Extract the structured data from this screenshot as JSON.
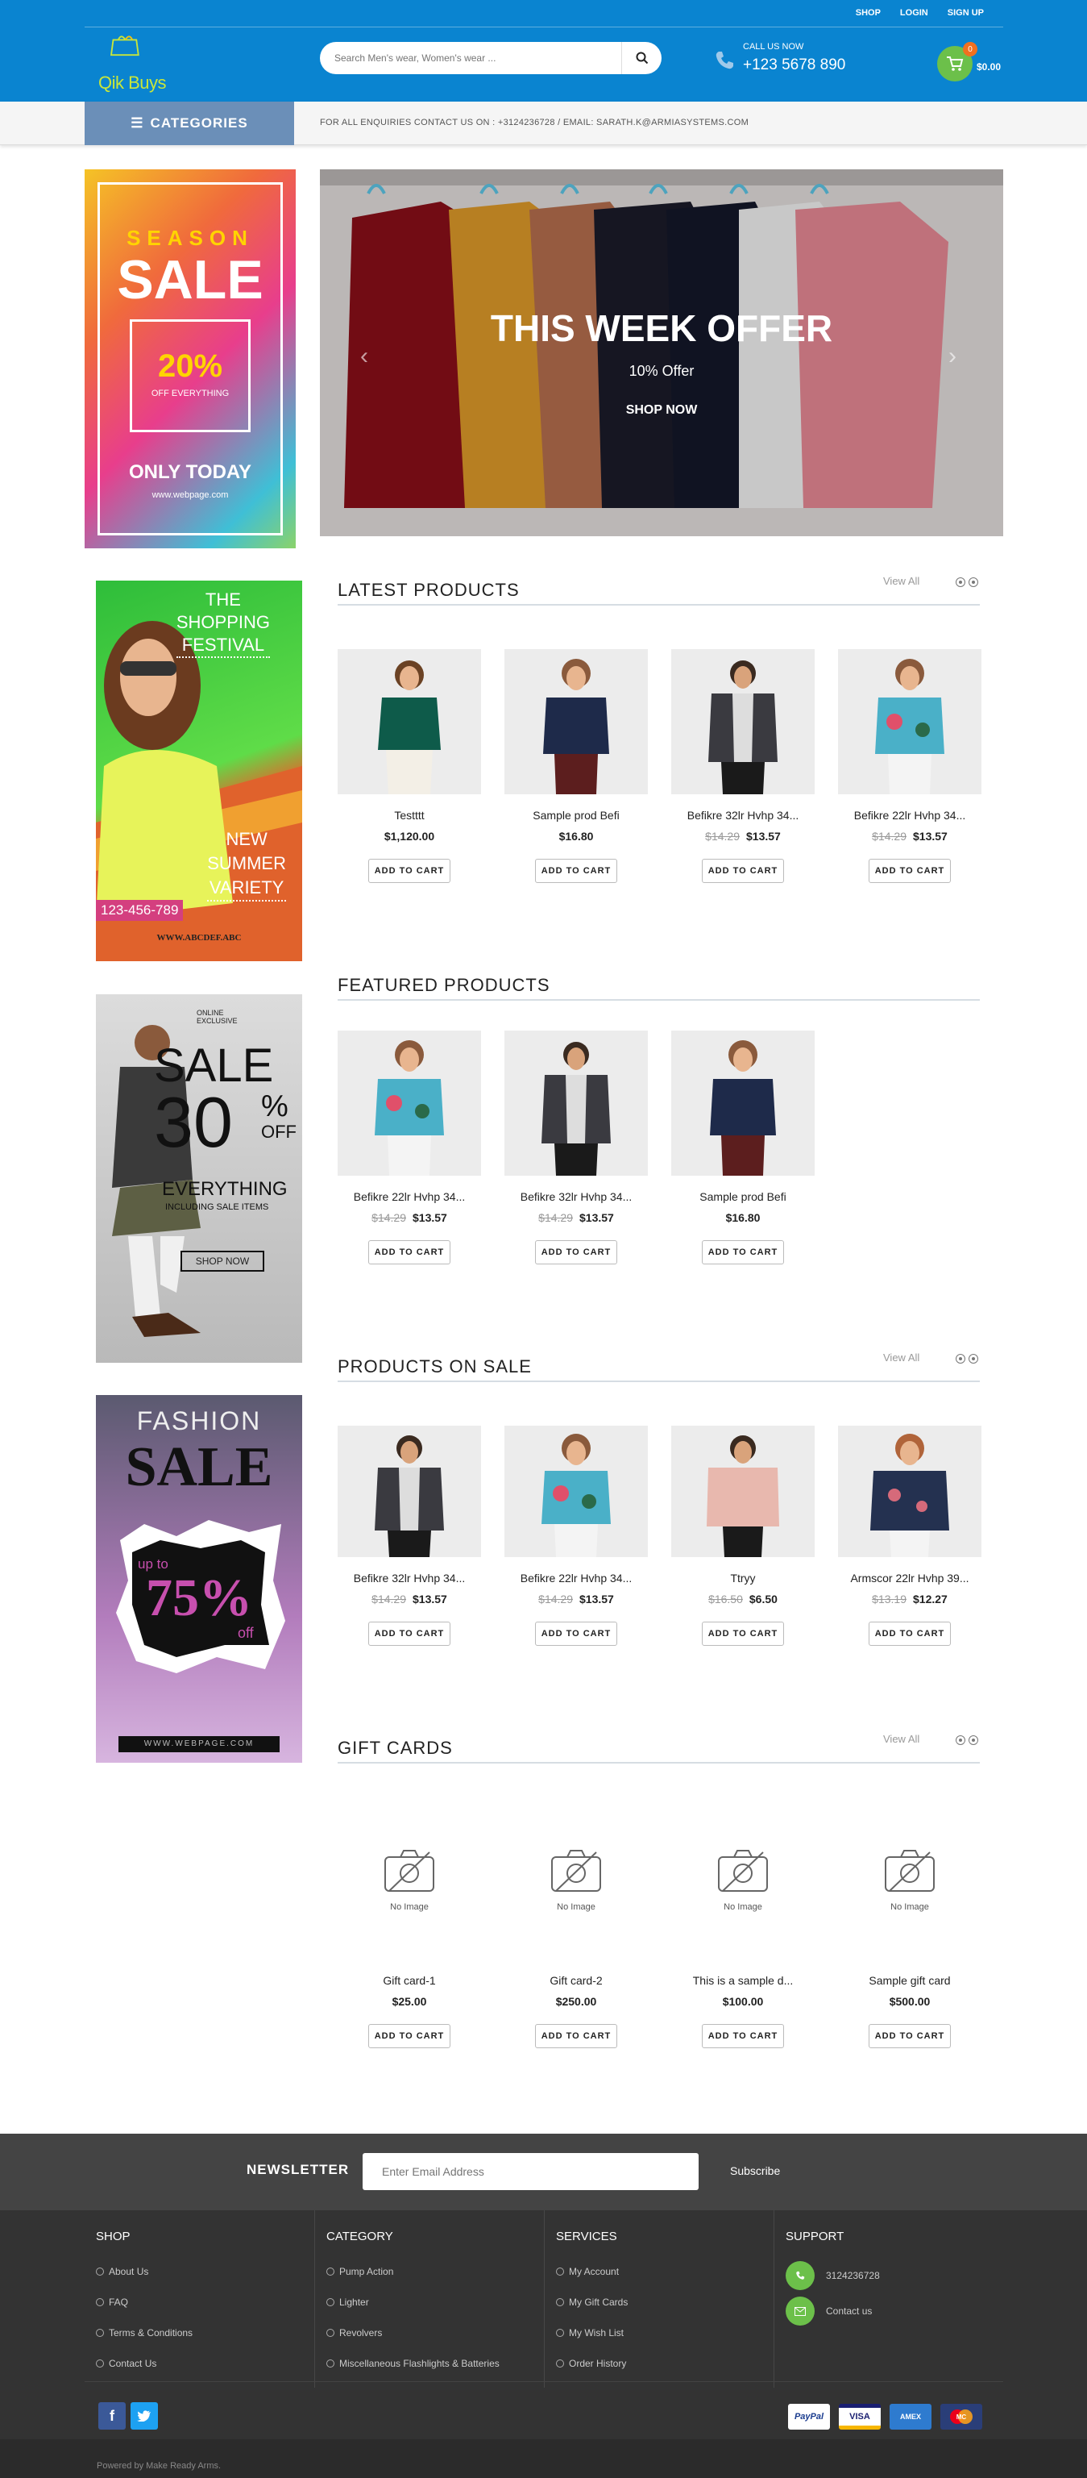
{
  "header": {
    "top_nav": [
      "SHOP",
      "LOGIN",
      "SIGN UP"
    ],
    "logo_text": "Qik Buys",
    "search_placeholder": "Search Men's wear, Women's wear ...",
    "call_label": "CALL US NOW",
    "phone": "+123 5678 890",
    "cart_count": "0",
    "cart_total": "$0.00"
  },
  "catbar": {
    "label": "CATEGORIES",
    "enquiry": "FOR ALL ENQUIRIES CONTACT US ON : +3124236728 / EMAIL: SARATH.K@ARMIASYSTEMS.COM"
  },
  "hero": {
    "title": "THIS WEEK OFFER",
    "subtitle": "10% Offer",
    "cta": "SHOP NOW"
  },
  "banners": {
    "season": {
      "line1": "SEASON",
      "line2": "SALE",
      "pct": "20%",
      "pct_sub": "OFF EVERYTHING",
      "only": "ONLY TODAY",
      "site": "www.webpage.com"
    },
    "festival": {
      "line1": "THE",
      "line2": "SHOPPING",
      "line3": "FESTIVAL",
      "new1": "NEW",
      "new2": "SUMMER",
      "new3": "VARIETY",
      "phone": "123-456-789",
      "site": "WWW.ABCDEF.ABC"
    },
    "sale30": {
      "top": "ONLINE EXCLUSIVE",
      "sale": "SALE",
      "num": "30",
      "pct": "%",
      "off": "OFF",
      "every": "EVERYTHING",
      "incl": "INCLUDING SALE ITEMS",
      "btn": "SHOP NOW"
    },
    "fashion": {
      "line1": "FASHION",
      "line2": "SALE",
      "upto": "up to",
      "pct": "75%",
      "off": "off",
      "site": "WWW.WEBPAGE.COM"
    }
  },
  "sections": {
    "latest": {
      "title": "LATEST PRODUCTS",
      "view_all": "View All",
      "items": [
        {
          "name": "Testttt",
          "old": "",
          "price": "$1,120.00"
        },
        {
          "name": "Sample prod Befi",
          "old": "",
          "price": "$16.80"
        },
        {
          "name": "Befikre 32lr Hvhp 34...",
          "old": "$14.29",
          "price": "$13.57"
        },
        {
          "name": "Befikre 22lr Hvhp 34...",
          "old": "$14.29",
          "price": "$13.57"
        }
      ]
    },
    "featured": {
      "title": "FEATURED PRODUCTS",
      "items": [
        {
          "name": "Befikre 22lr Hvhp 34...",
          "old": "$14.29",
          "price": "$13.57"
        },
        {
          "name": "Befikre 32lr Hvhp 34...",
          "old": "$14.29",
          "price": "$13.57"
        },
        {
          "name": "Sample prod Befi",
          "old": "",
          "price": "$16.80"
        }
      ]
    },
    "sale": {
      "title": "PRODUCTS ON SALE",
      "view_all": "View All",
      "items": [
        {
          "name": "Befikre 32lr Hvhp 34...",
          "old": "$14.29",
          "price": "$13.57"
        },
        {
          "name": "Befikre 22lr Hvhp 34...",
          "old": "$14.29",
          "price": "$13.57"
        },
        {
          "name": "Ttryy",
          "old": "$16.50",
          "price": "$6.50"
        },
        {
          "name": "Armscor 22lr Hvhp 39...",
          "old": "$13.19",
          "price": "$12.27"
        }
      ]
    },
    "gift": {
      "title": "GIFT CARDS",
      "view_all": "View All",
      "no_image": "No Image",
      "items": [
        {
          "name": "Gift card-1",
          "price": "$25.00"
        },
        {
          "name": "Gift card-2",
          "price": "$250.00"
        },
        {
          "name": "This is a sample d...",
          "price": "$100.00"
        },
        {
          "name": "Sample gift card",
          "price": "$500.00"
        }
      ]
    },
    "add_to_cart": "ADD TO CART"
  },
  "footer": {
    "newsletter_title": "NEWSLETTER",
    "newsletter_placeholder": "Enter Email Address",
    "subscribe": "Subscribe",
    "columns": [
      {
        "title": "SHOP",
        "links": [
          "About Us",
          "FAQ",
          "Terms & Conditions",
          "Contact Us"
        ]
      },
      {
        "title": "CATEGORY",
        "links": [
          "Pump Action",
          "Lighter",
          "Revolvers",
          "Miscellaneous Flashlights & Batteries"
        ]
      },
      {
        "title": "SERVICES",
        "links": [
          "My Account",
          "My Gift Cards",
          "My Wish List",
          "Order History"
        ]
      }
    ],
    "support": {
      "title": "SUPPORT",
      "phone": "3124236728",
      "contact": "Contact us"
    },
    "payments": [
      "PayPal",
      "VISA",
      "AMEX",
      "MC"
    ],
    "powered": "Powered by Make Ready Arms."
  }
}
